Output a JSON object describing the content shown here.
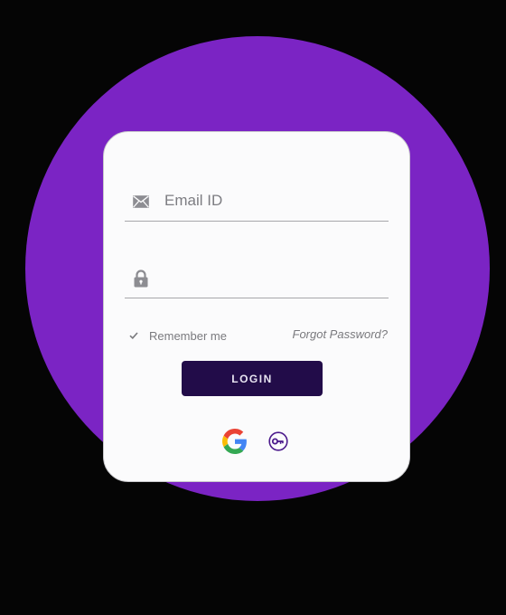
{
  "login_form": {
    "email": {
      "icon": "envelope-icon",
      "placeholder": "Email ID",
      "value": ""
    },
    "password": {
      "icon": "lock-icon",
      "placeholder": "",
      "value": ""
    },
    "remember": {
      "icon": "check-icon",
      "label": "Remember me",
      "checked": true
    },
    "forgot_password_label": "Forgot Password?",
    "login_button_label": "LOGIN",
    "social_logins": [
      {
        "icon": "google-icon"
      },
      {
        "icon": "key-icon"
      }
    ]
  },
  "colors": {
    "background": "#050505",
    "circle": "#7b24c4",
    "card": "#fbfbfc",
    "button": "#220c49",
    "key_icon": "#4b1a8c"
  }
}
